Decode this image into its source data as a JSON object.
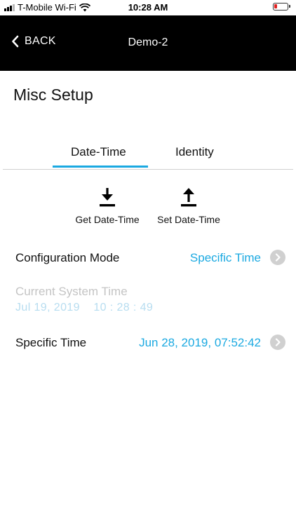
{
  "status_bar": {
    "carrier": "T-Mobile Wi-Fi",
    "time": "10:28 AM"
  },
  "nav": {
    "back_label": "BACK",
    "title": "Demo-2"
  },
  "page": {
    "title": "Misc Setup"
  },
  "tabs": [
    {
      "label": "Date-Time",
      "active": true
    },
    {
      "label": "Identity",
      "active": false
    }
  ],
  "actions": {
    "get_label": "Get Date-Time",
    "set_label": "Set Date-Time"
  },
  "config_mode": {
    "label": "Configuration Mode",
    "value": "Specific Time"
  },
  "current_system_time": {
    "label": "Current System Time",
    "value": "Jul 19, 2019    10 : 28 : 49"
  },
  "specific_time": {
    "label": "Specific Time",
    "value": "Jun 28, 2019, 07:52:42"
  },
  "colors": {
    "accent": "#1ba9e1",
    "navbar": "#000000",
    "battery_low": "#e02020"
  }
}
